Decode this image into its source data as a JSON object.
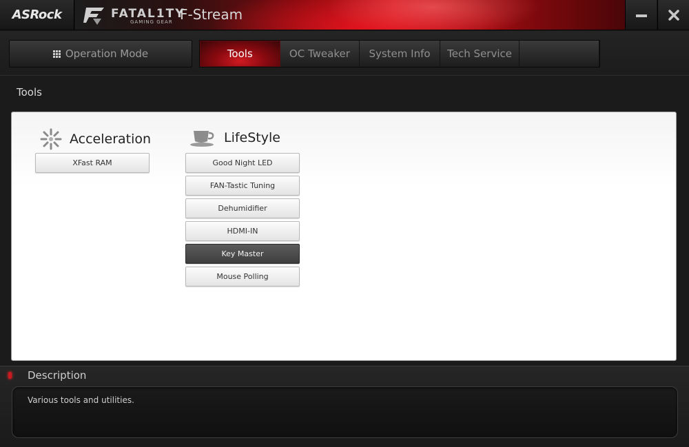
{
  "title_bar": {
    "brand_logo": "ASRock",
    "fatality_logo": "FATAL1TY",
    "fatality_sub": "GAMING GEAR",
    "app_name": "F-Stream",
    "minimize_icon": "minimize-icon",
    "close_icon": "close-icon"
  },
  "nav": {
    "operation_mode_label": "Operation Mode",
    "tabs": [
      {
        "label": "Tools",
        "active": true
      },
      {
        "label": "OC Tweaker",
        "active": false
      },
      {
        "label": "System Info",
        "active": false
      },
      {
        "label": "Tech Service",
        "active": false
      }
    ]
  },
  "page": {
    "section_title": "Tools"
  },
  "categories": {
    "acceleration": {
      "title": "Acceleration",
      "icon": "acceleration-burst-icon",
      "items": [
        "XFast RAM"
      ]
    },
    "lifestyle": {
      "title": "LifeStyle",
      "icon": "coffee-cup-icon",
      "items": [
        "Good Night LED",
        "FAN-Tastic Tuning",
        "Dehumidifier",
        "HDMI-IN",
        "Key Master",
        "Mouse Polling"
      ],
      "selected": "Key Master"
    }
  },
  "description": {
    "title": "Description",
    "text": "Various tools and utilities."
  },
  "colors": {
    "accent_red": "#c41018",
    "selected_button": "#4a4a4a"
  }
}
